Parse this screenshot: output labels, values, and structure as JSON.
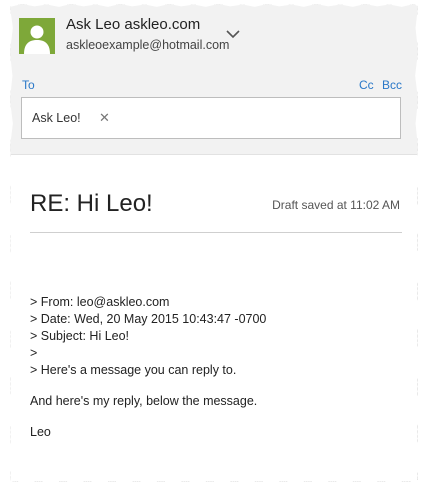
{
  "account": {
    "name": "Ask Leo askleo.com",
    "email": "askleoexample@hotmail.com",
    "avatar_color": "#7ea839"
  },
  "recipients": {
    "to_label": "To",
    "cc_label": "Cc",
    "bcc_label": "Bcc",
    "to_chip": "Ask Leo!",
    "remove_glyph": "✕"
  },
  "compose": {
    "subject": "RE: Hi Leo!",
    "draft_status": "Draft saved at 11:02 AM",
    "quoted": [
      "> From: leo@askleo.com",
      "> Date: Wed, 20 May 2015 10:43:47 -0700",
      "> Subject: Hi Leo!",
      ">",
      "> Here's a message you can reply to."
    ],
    "reply": "And here's my reply, below the message.",
    "signature": "Leo"
  },
  "colors": {
    "accent": "#2a78c8",
    "header_bg": "#f2f2f2"
  }
}
